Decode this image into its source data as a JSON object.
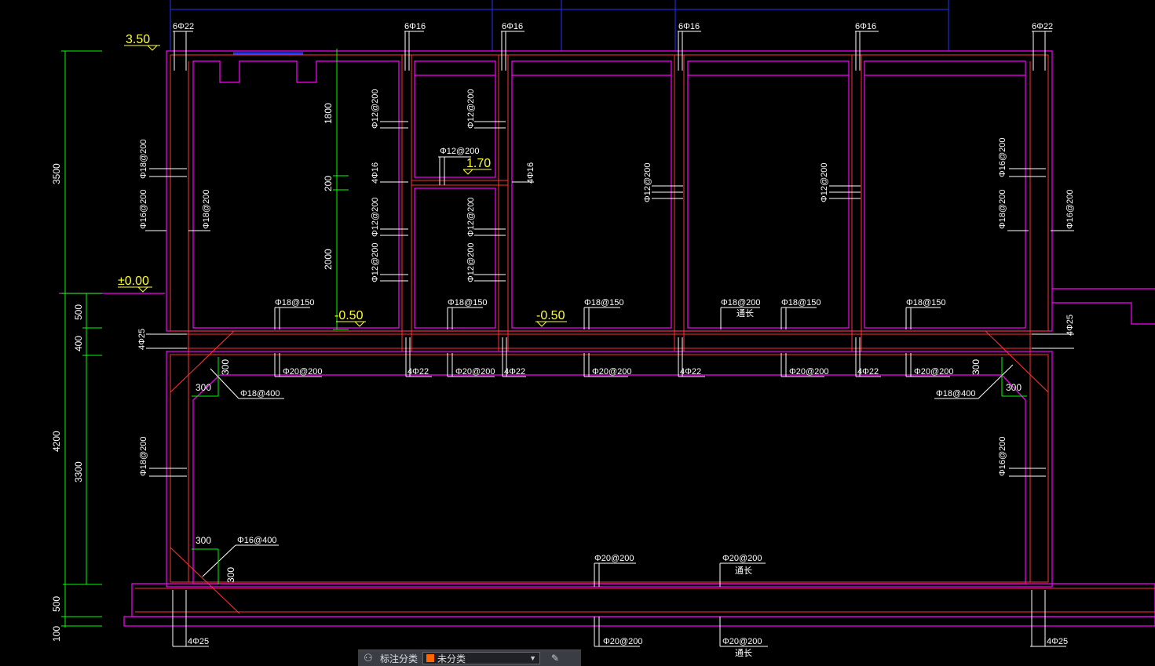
{
  "colors": {
    "wall": "#ff00ff",
    "rebar": "#ff3333",
    "dim": "#00ff00",
    "elevation": "#ffff33",
    "grid": "#2233ff",
    "text": "#ffffff",
    "category_swatch": "#ff6600"
  },
  "elevations": {
    "top": "3.50",
    "ground": "±0.00",
    "stair": "1.70",
    "floor_left": "-0.50",
    "floor_mid": "-0.50"
  },
  "dimensions": {
    "left_total_upper": "3500",
    "left_total_lower": "4200",
    "left_500_a": "500",
    "left_400": "400",
    "left_3300": "3300",
    "left_500_b": "500",
    "left_100": "100",
    "inner_1800": "1800",
    "inner_200": "200",
    "inner_2000": "2000",
    "haunch": "300"
  },
  "labels": {
    "bar_6d22": "6Φ22",
    "bar_6d16": "6Φ16",
    "bar_4d25": "4Φ25",
    "bar_4d22": "4Φ22",
    "bar_4d16": "4Φ16",
    "bar_d18_200": "Φ18@200",
    "bar_d16_200": "Φ16@200",
    "bar_d12_200": "Φ12@200",
    "bar_d18_150": "Φ18@150",
    "bar_d20_200": "Φ20@200",
    "bar_d18_400": "Φ18@400",
    "bar_d16_400": "Φ16@400",
    "bar_d12_200_stair": "Φ12@200",
    "tongchang": "通长"
  },
  "toolbar": {
    "icon": "layers-icon",
    "label": "标注分类",
    "value": "未分类",
    "edit_icon": "edit-icon"
  }
}
